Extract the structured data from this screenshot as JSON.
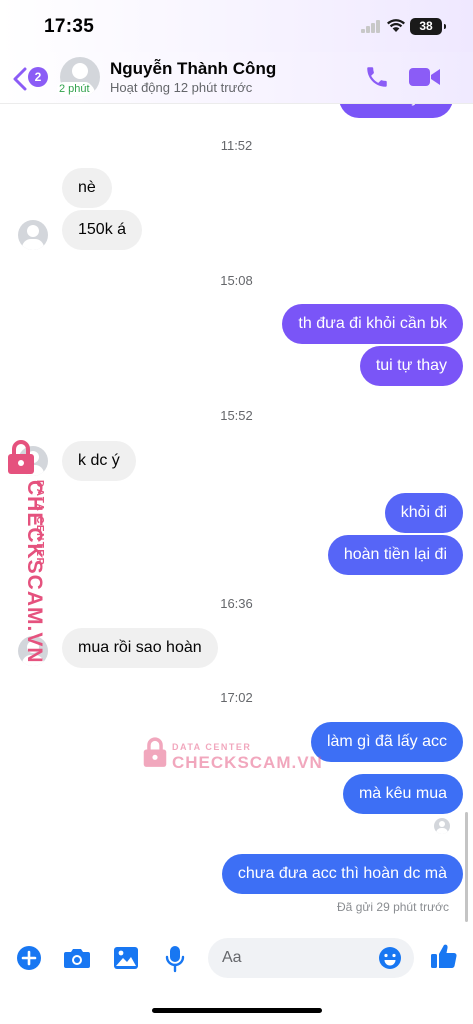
{
  "status_bar": {
    "time": "17:35",
    "battery": "38"
  },
  "header": {
    "back_badge": "2",
    "avatar_active_label": "2 phút",
    "contact_name": "Nguyễn Thành Công",
    "activity": "Hoạt động 12 phút trước",
    "icons": [
      "phone-icon",
      "video-call-icon"
    ]
  },
  "messages": {
    "top_partial": "tiền chuyển",
    "ts1": "11:52",
    "m1": "nè",
    "m2": "150k á",
    "ts2": "15:08",
    "m3": "th đưa đi khỏi cần bk",
    "m4": "tui tự thay",
    "ts3": "15:52",
    "m5": "k dc ý",
    "m6": "khỏi đi",
    "m7": "hoàn tiền lại đi",
    "ts4": "16:36",
    "m8": "mua rồi sao hoàn",
    "ts5": "17:02",
    "m9": "làm gì đã lấy acc",
    "m10": "mà kêu mua",
    "m11": "chưa đưa acc thì hoàn dc mà",
    "sent_status": "Đã gửi 29 phút trước"
  },
  "watermark": {
    "brand": "CHECKSCAM.VN",
    "sub": "DATA CENTER"
  },
  "composer": {
    "placeholder": "Aa",
    "icons": [
      "plus-icon",
      "camera-icon",
      "gallery-icon",
      "microphone-icon",
      "emoji-icon",
      "like-icon"
    ]
  },
  "colors": {
    "accent": "#7a55f7",
    "incoming": "#f0f0f0",
    "blue": "#3d6ff5",
    "watermark": "#e5527e"
  }
}
